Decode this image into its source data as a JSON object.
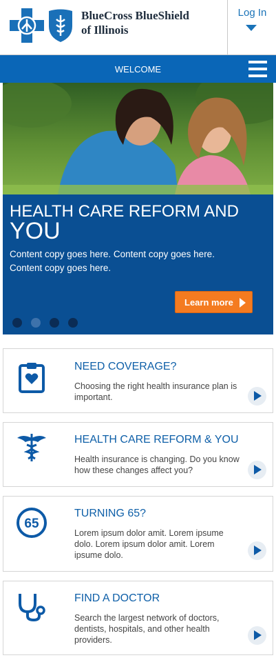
{
  "header": {
    "brand_line1": "BlueCross BlueShield",
    "brand_line2": "of Illinois",
    "login_label": "Log In"
  },
  "navbar": {
    "title": "WELCOME"
  },
  "hero": {
    "title_line1": "HEALTH CARE REFORM AND",
    "title_line2": "YOU",
    "copy": "Content copy goes here. Content copy goes here. Content copy goes here.",
    "button_label": "Learn more",
    "slides_total": 4,
    "active_slide": 2
  },
  "cards": [
    {
      "title": "NEED COVERAGE?",
      "description": "Choosing the right health insurance plan is important.",
      "icon": "clipboard-heart-icon"
    },
    {
      "title": "HEALTH CARE REFORM & YOU",
      "description": "Health insurance is changing. Do you know how these changes affect you?",
      "icon": "caduceus-icon"
    },
    {
      "title": "TURNING 65?",
      "description": "Lorem ipsum dolor amit. Lorem ipsume dolo. Lorem ipsum dolor amit. Lorem ipsume dolo.",
      "icon": "sixty-five-icon",
      "badge_text": "65"
    },
    {
      "title": "FIND A DOCTOR",
      "description": "Search the largest network of doctors, dentists, hospitals, and other health providers.",
      "icon": "stethoscope-icon"
    }
  ],
  "colors": {
    "brand_blue": "#0a66b7",
    "hero_blue": "#0a4f93",
    "accent_orange": "#f47b20",
    "card_title_blue": "#0e5fa8"
  }
}
